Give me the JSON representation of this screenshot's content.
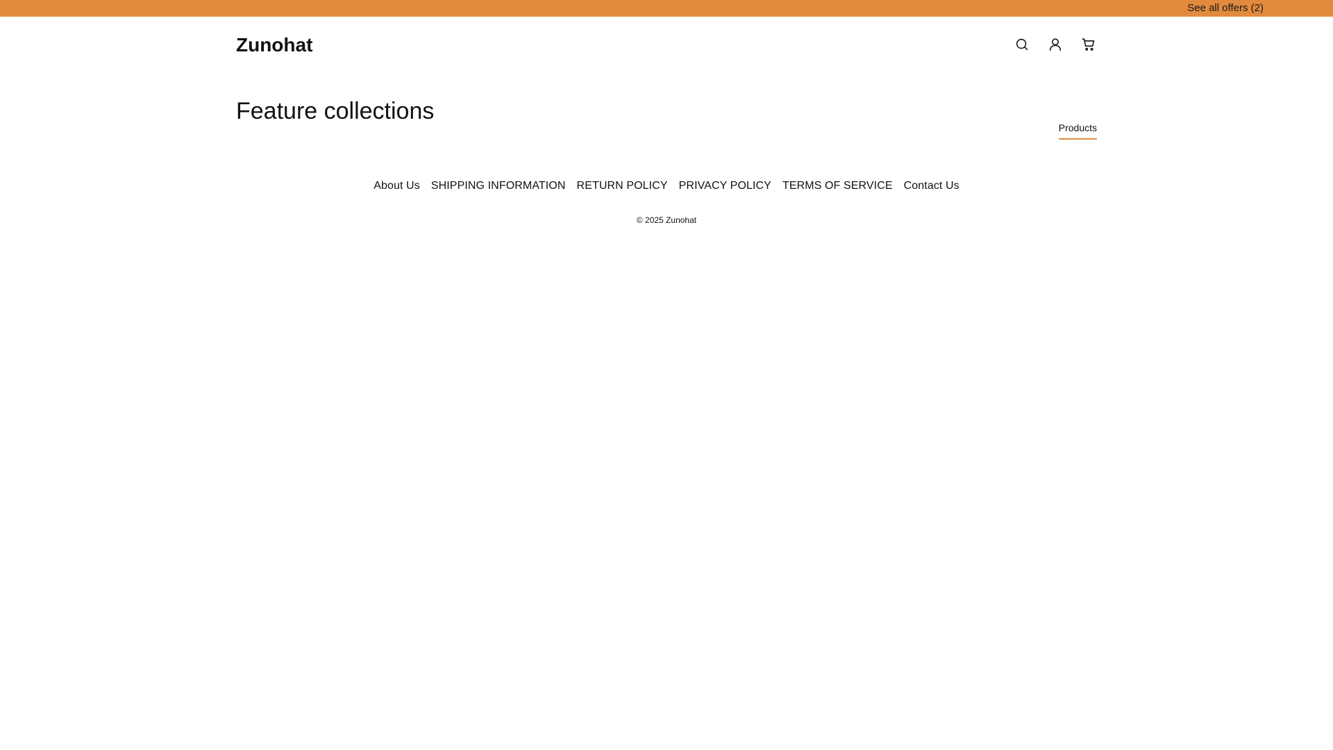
{
  "offer_bar": {
    "link_text": "See all offers (2)",
    "background_color": "#E28B3E"
  },
  "header": {
    "logo": "Zunohat",
    "icons": [
      "search-icon",
      "account-icon",
      "cart-icon"
    ]
  },
  "collection": {
    "title": "Feature collections",
    "tab_label": "Products",
    "tab_accent_color": "#E28B3E"
  },
  "footer": {
    "links": [
      "About Us",
      "SHIPPING INFORMATION",
      "RETURN POLICY",
      "PRIVACY POLICY",
      "TERMS OF SERVICE",
      "Contact Us"
    ],
    "copyright": "© 2025 Zunohat"
  }
}
